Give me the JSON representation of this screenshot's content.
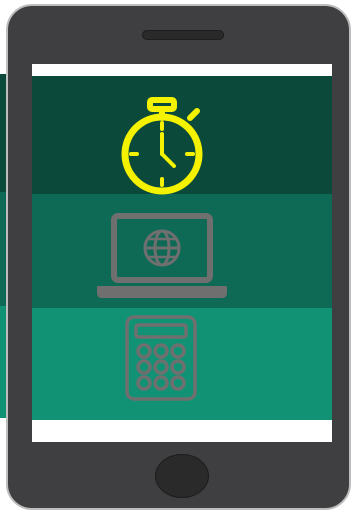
{
  "illustration": {
    "subject": "phone",
    "icons": [
      "stopwatch-icon",
      "laptop-globe-icon",
      "calculator-icon"
    ],
    "colors": {
      "phone_body": "#3f3f41",
      "screen": "#ffffff",
      "panel_dark": "#0b4a3a",
      "panel_mid": "#0f6a55",
      "panel_light": "#129274",
      "stopwatch": "#f4f200",
      "inactive_icon": "#6f6f6f"
    }
  }
}
